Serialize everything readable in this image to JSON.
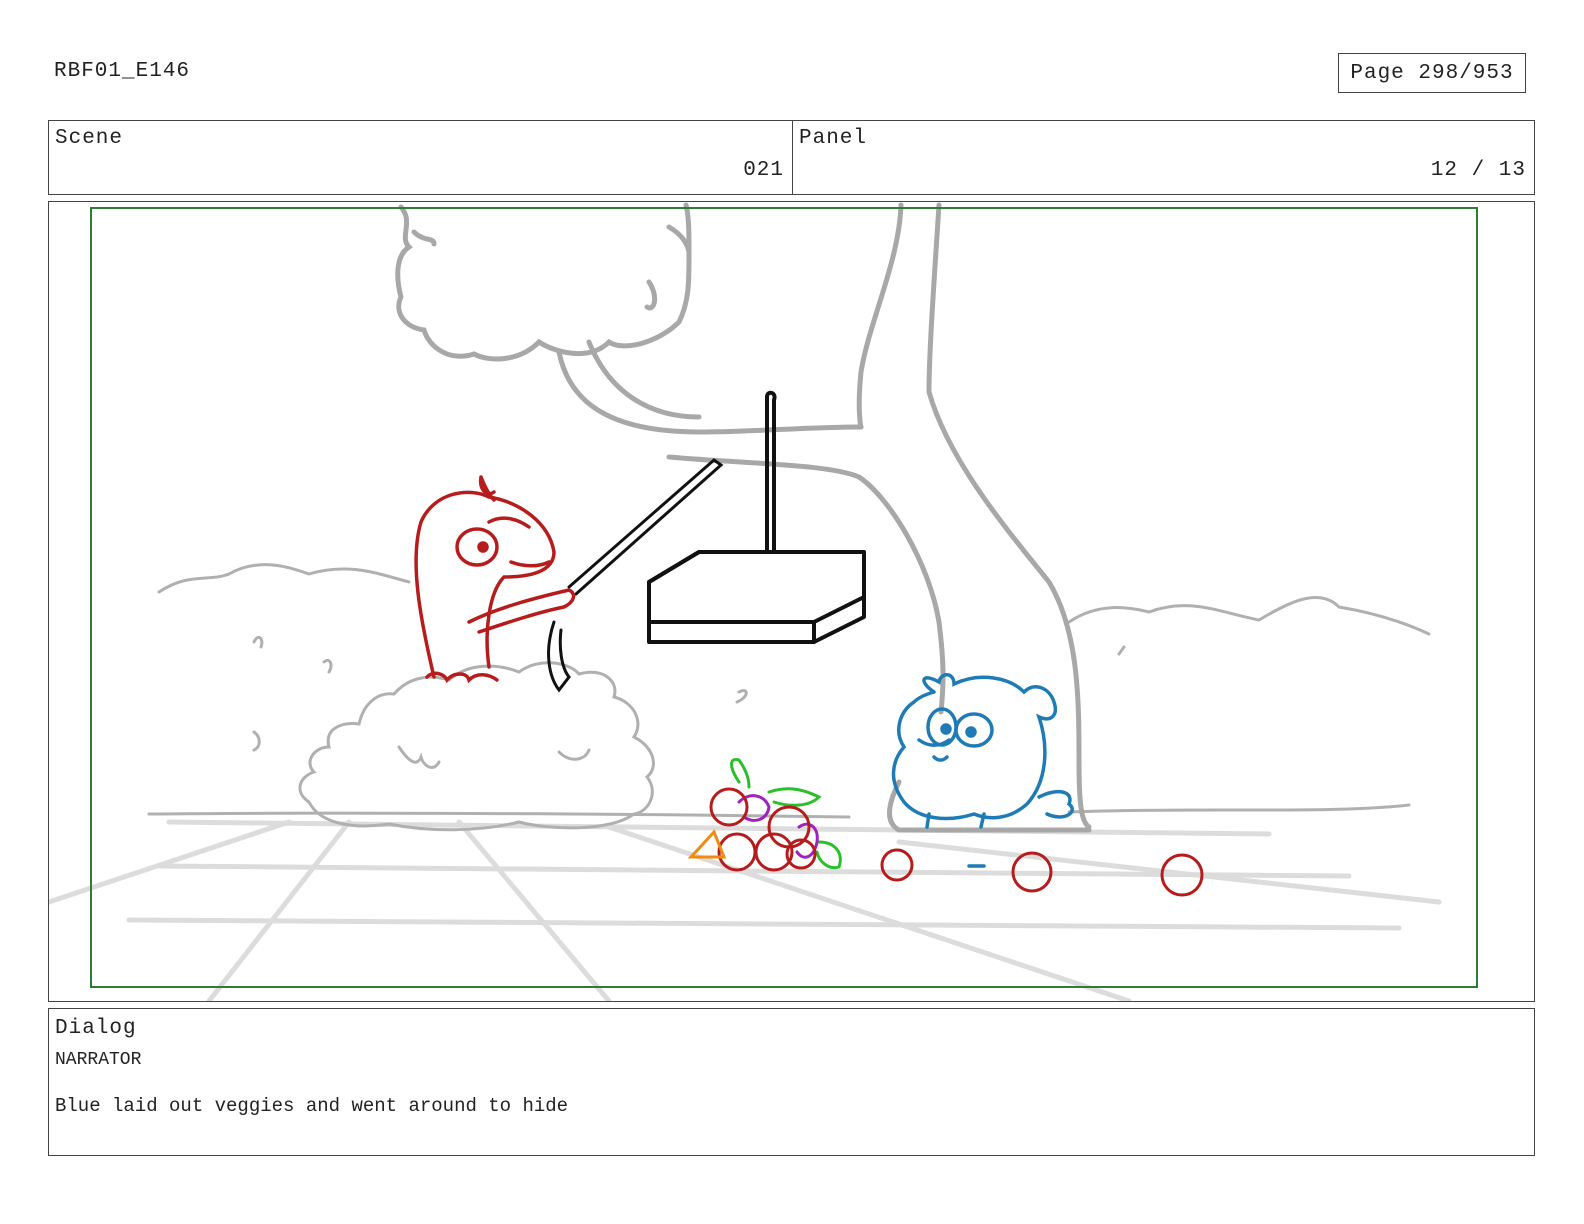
{
  "document": {
    "id": "RBF01_E146",
    "page": "Page 298/953"
  },
  "header": {
    "scene_label": "Scene",
    "scene_value": "021",
    "panel_label": "Panel",
    "panel_value": "12 / 13"
  },
  "dialog": {
    "label": "Dialog",
    "speaker": "NARRATOR",
    "line": "Blue laid out veggies and went around to hide"
  },
  "colors": {
    "safe_frame": "#2e7d32",
    "red_character": "#b71c1c",
    "blue_character": "#1f7bb6",
    "background_lines": "#b0b0b0"
  },
  "icons": {
    "red_bird": "red-bird-character",
    "blue_bird": "blue-bird-character",
    "trap": "box-trap",
    "veggies": "veggie-pile"
  }
}
